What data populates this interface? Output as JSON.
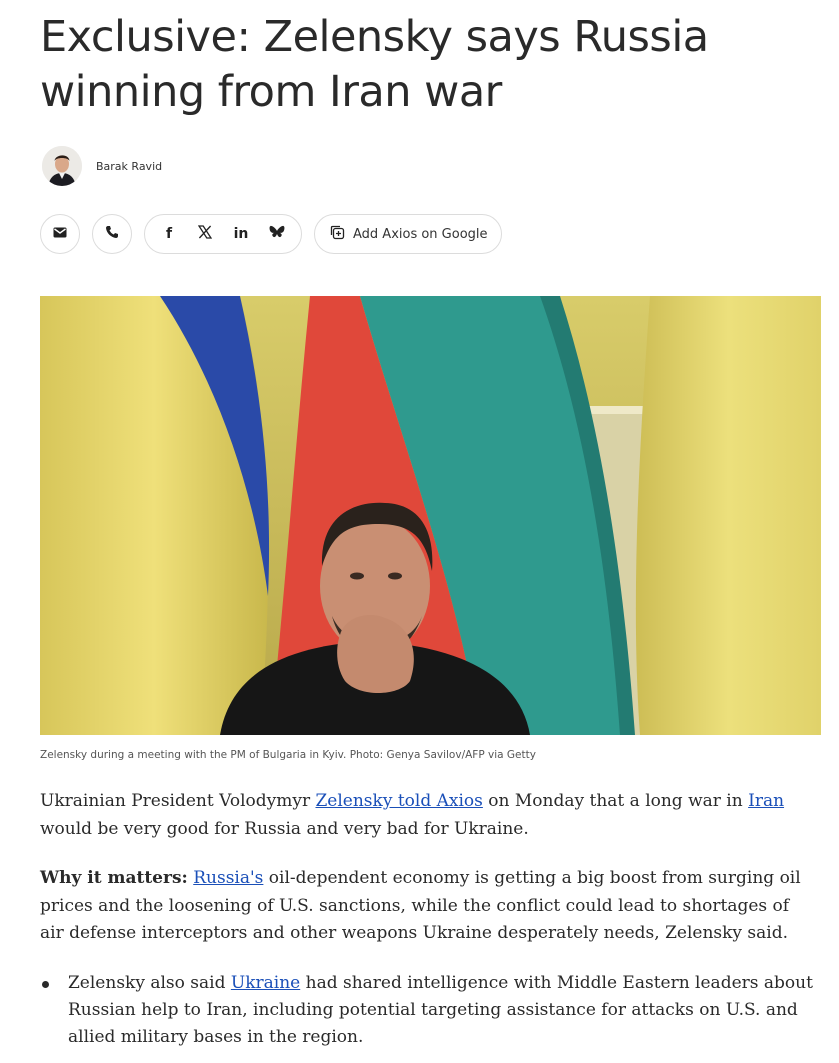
{
  "article": {
    "headline": "Exclusive: Zelensky says Russia winning from Iran war",
    "author": "Barak Ravid",
    "share": {
      "email_icon": "email-icon",
      "phone_icon": "phone-icon",
      "facebook_icon": "facebook-icon",
      "x_icon": "x-icon",
      "linkedin_icon": "linkedin-icon",
      "bluesky_icon": "bluesky-icon",
      "google_label": "Add Axios on Google"
    },
    "image_caption": "Zelensky during a meeting with the PM of Bulgaria in Kyiv. Photo: Genya Savilov/AFP via Getty",
    "p1": {
      "t1": "Ukrainian President Volodymyr ",
      "link1": "Zelensky told Axios",
      "t2": " on Monday that a long war in ",
      "link2": "Iran",
      "t3": " would be very good for Russia and very bad for Ukraine."
    },
    "p2": {
      "lead": "Why it matters:",
      "link": "Russia's",
      "t1": " oil-dependent economy is getting a big boost from surging oil prices and the loosening of U.S. sanctions, while the conflict could lead to shortages of air defense interceptors and other weapons Ukraine desperately needs, Zelensky said."
    },
    "bullet1": {
      "t1": "Zelensky also said ",
      "link": "Ukraine",
      "t2": " had shared intelligence with Middle Eastern leaders about Russian help to Iran, including potential targeting assistance for attacks on U.S. and allied military bases in the region."
    },
    "colors": {
      "link": "#1a4fb8",
      "text": "#2a2a2a",
      "flag_yellow": "#e2d165",
      "flag_blue": "#2a4aa8",
      "flag_red": "#e0483a",
      "flag_teal": "#2f9a8e"
    }
  }
}
